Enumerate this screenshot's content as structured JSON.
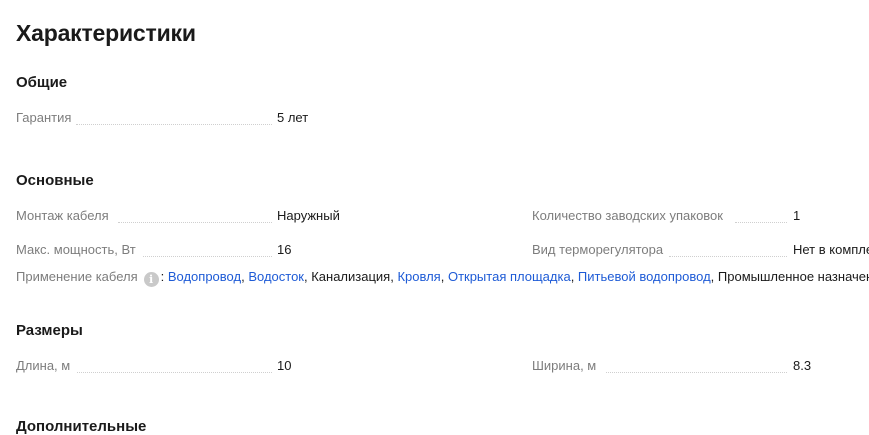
{
  "title": "Характеристики",
  "sections": {
    "general": {
      "title": "Общие",
      "warranty_label": "Гарантия",
      "warranty_value": "5 лет"
    },
    "main": {
      "title": "Основные",
      "mount_label": "Монтаж кабеля",
      "mount_value": "Наружный",
      "packs_label": "Количество заводских упаковок",
      "packs_value": "1",
      "power_label": "Макс. мощность, Вт",
      "power_value": "16",
      "thermo_label": "Вид терморегулятора",
      "thermo_value": "Нет в комплекте",
      "apply_label": "Применение кабеля",
      "info_icon": "i",
      "apply_items": [
        {
          "text": "Водопровод",
          "link": true
        },
        {
          "text": "Водосток",
          "link": true
        },
        {
          "text": "Канализация",
          "link": false
        },
        {
          "text": "Кровля",
          "link": true
        },
        {
          "text": "Открытая площадка",
          "link": true
        },
        {
          "text": "Питьевой водопровод",
          "link": true
        },
        {
          "text": "Промышленное назначение",
          "link": false
        }
      ]
    },
    "dimensions": {
      "title": "Размеры",
      "length_label": "Длина, м",
      "length_value": "10",
      "width_label": "Ширина, м",
      "width_value": "8.3"
    },
    "additional": {
      "title": "Дополнительные"
    }
  },
  "colors": {
    "link": "#1e5bd6",
    "label": "#7d7d7d",
    "dots": "#cfcfcf"
  }
}
